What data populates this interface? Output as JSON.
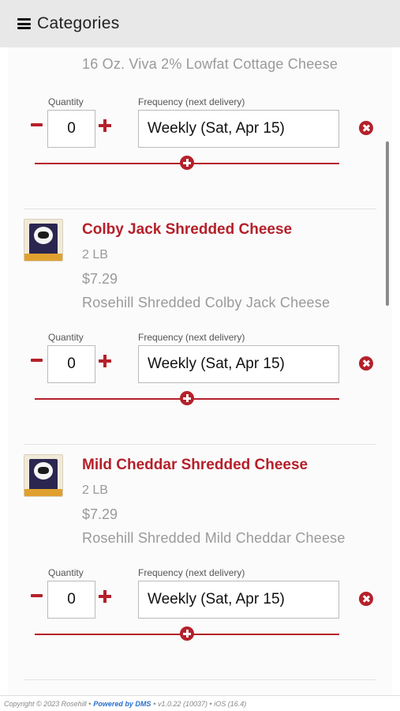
{
  "header": {
    "title": "Categories",
    "menu_icon": "hamburger-menu-icon"
  },
  "labels": {
    "quantity": "Quantity",
    "frequency": "Frequency (next delivery)"
  },
  "products": [
    {
      "name": "",
      "size": "",
      "price": "",
      "description": "16 Oz. Viva 2% Lowfat Cottage Cheese",
      "quantity": "0",
      "frequency": "Weekly (Sat, Apr 15)"
    },
    {
      "name": "Colby Jack Shredded Cheese",
      "size": "2 LB",
      "price": "$7.29",
      "description": "Rosehill Shredded Colby Jack Cheese",
      "quantity": "0",
      "frequency": "Weekly (Sat, Apr 15)"
    },
    {
      "name": "Mild Cheddar Shredded Cheese",
      "size": "2 LB",
      "price": "$7.29",
      "description": "Rosehill Shredded Mild Cheddar Cheese",
      "quantity": "0",
      "frequency": "Weekly (Sat, Apr 15)"
    }
  ],
  "footer": {
    "copyright": "Copyright © 2023 Rosehill •",
    "powered": "Powered by DMS",
    "version": "• v1.0.22 (10037) • iOS (16.4)"
  },
  "colors": {
    "accent": "#b5202a",
    "muted_text": "#9a9a9a",
    "header_bg": "#e8e8e8"
  }
}
